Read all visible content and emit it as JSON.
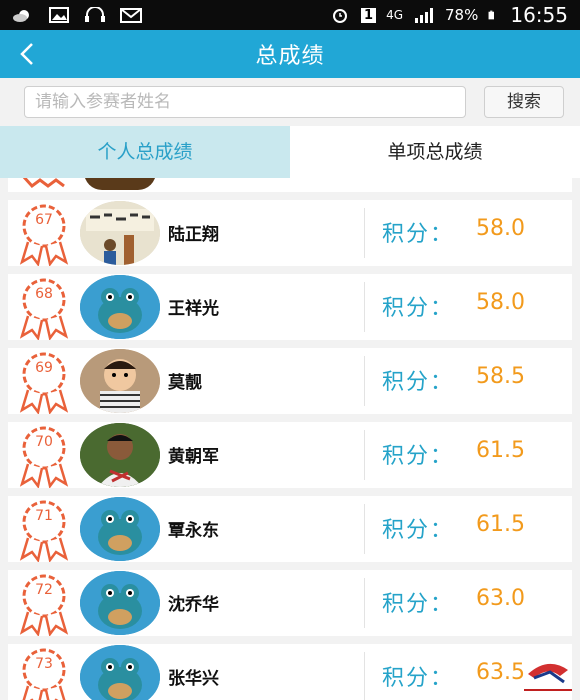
{
  "status_bar": {
    "network": "4G",
    "sim": "1",
    "battery_percent": "78%",
    "time": "16:55"
  },
  "header": {
    "title": "总成绩"
  },
  "search": {
    "placeholder": "请输入参赛者姓名",
    "button_label": "搜索"
  },
  "tabs": [
    {
      "label": "个人总成绩",
      "active": true
    },
    {
      "label": "单项总成绩",
      "active": false
    }
  ],
  "colors": {
    "header": "#21a7d6",
    "active_tab": "#c9e8ee",
    "score_label": "#25a3c9",
    "score_value": "#f29a1c",
    "badge": "#e9613a"
  },
  "rows": [
    {
      "rank": "67",
      "name": "陆正翔",
      "score_label": "积分：",
      "score": "58.0",
      "avatar": "photo-calligraphy"
    },
    {
      "rank": "68",
      "name": "王祥光",
      "score_label": "积分：",
      "score": "58.0",
      "avatar": "default-frog"
    },
    {
      "rank": "69",
      "name": "莫靓",
      "score_label": "积分：",
      "score": "58.5",
      "avatar": "photo-child"
    },
    {
      "rank": "70",
      "name": "黄朝军",
      "score_label": "积分：",
      "score": "61.5",
      "avatar": "photo-man"
    },
    {
      "rank": "71",
      "name": "覃永东",
      "score_label": "积分：",
      "score": "61.5",
      "avatar": "default-frog"
    },
    {
      "rank": "72",
      "name": "沈乔华",
      "score_label": "积分：",
      "score": "63.0",
      "avatar": "default-frog"
    },
    {
      "rank": "73",
      "name": "张华兴",
      "score_label": "积分：",
      "score": "63.5",
      "avatar": "default-frog"
    }
  ]
}
